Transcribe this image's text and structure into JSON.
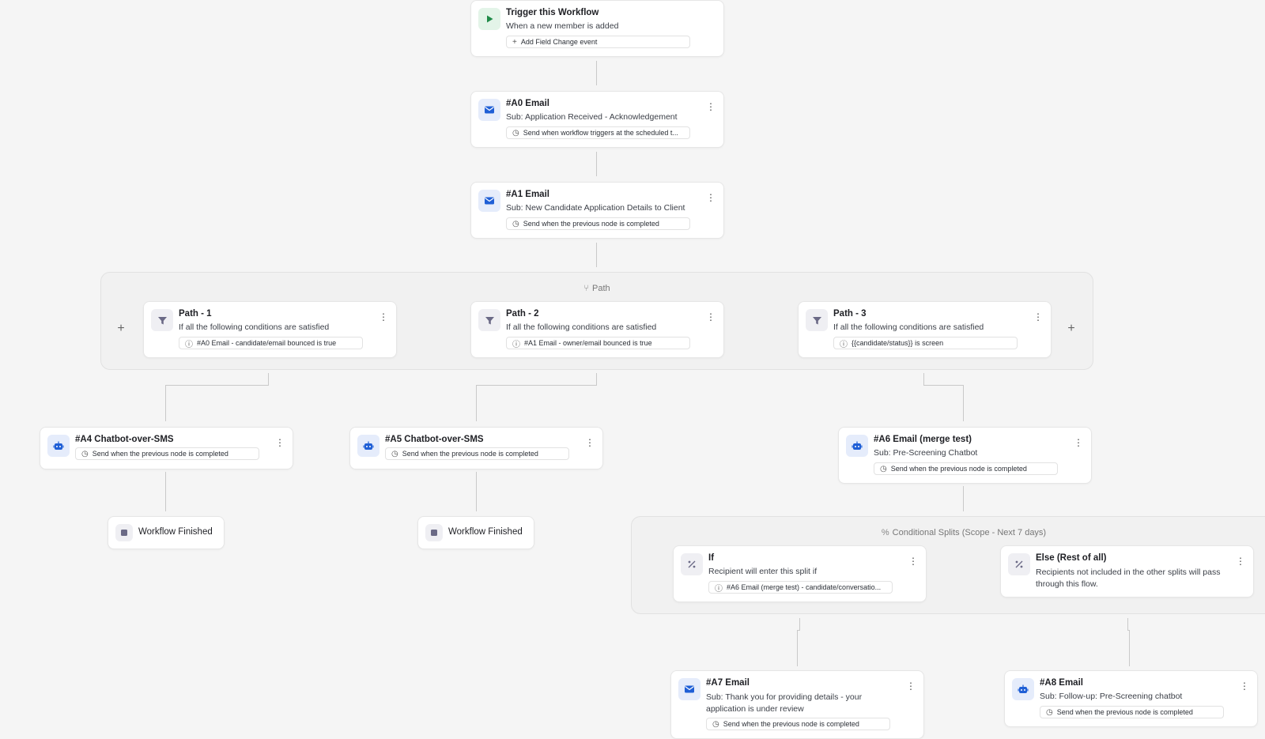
{
  "trigger": {
    "title": "Trigger this Workflow",
    "subtitle": "When a new member is added",
    "pill": "Add Field Change event",
    "icon": "play-icon"
  },
  "a0": {
    "title": "#A0 Email",
    "subtitle": "Sub: Application Received - Acknowledgement",
    "pill": "Send when workflow triggers at the scheduled t...",
    "icon": "mail-icon"
  },
  "a1": {
    "title": "#A1 Email",
    "subtitle": "Sub: New Candidate Application Details to Client",
    "pill": "Send when the previous node is completed",
    "icon": "mail-icon"
  },
  "path_group": {
    "label": "Path",
    "paths": [
      {
        "title": "Path - 1",
        "subtitle": "If all the following conditions are satisfied",
        "pill": "#A0 Email - candidate/email bounced is true"
      },
      {
        "title": "Path - 2",
        "subtitle": "If all the following conditions are satisfied",
        "pill": "#A1 Email - owner/email bounced is true"
      },
      {
        "title": "Path - 3",
        "subtitle": "If all the following conditions are satisfied",
        "pill": "{{candidate/status}} is screen"
      }
    ],
    "add_left": "+",
    "add_right": "+"
  },
  "a4": {
    "title": "#A4 Chatbot-over-SMS",
    "pill": "Send when the previous node is completed",
    "icon": "bot-icon"
  },
  "a5": {
    "title": "#A5 Chatbot-over-SMS",
    "pill": "Send when the previous node is completed",
    "icon": "bot-icon"
  },
  "a6": {
    "title": "#A6 Email (merge test)",
    "subtitle": "Sub: Pre-Screening Chatbot",
    "pill": "Send when the previous node is completed",
    "icon": "mail-icon"
  },
  "finished": {
    "label": "Workflow Finished"
  },
  "splits": {
    "label": "Conditional Splits (Scope - Next 7 days)",
    "if": {
      "title": "If",
      "subtitle": "Recipient will enter this split if",
      "pill": "#A6 Email (merge test) - candidate/conversatio..."
    },
    "else": {
      "title": "Else (Rest of all)",
      "subtitle": "Recipients not included in the other splits will pass through this flow."
    }
  },
  "a7": {
    "title": "#A7 Email",
    "subtitle": "Sub: Thank you for providing details - your application is under review",
    "pill": "Send when the previous node is completed"
  },
  "a8": {
    "title": "#A8 Email",
    "subtitle": "Sub: Follow-up: Pre-Screening chatbot",
    "pill": "Send when the previous node is completed"
  },
  "colors": {
    "accent_blue": "#1f5fd6",
    "accent_green": "#1f8a48",
    "neutral_icon": "#6b6a86",
    "connector": "#c9c9c9"
  }
}
